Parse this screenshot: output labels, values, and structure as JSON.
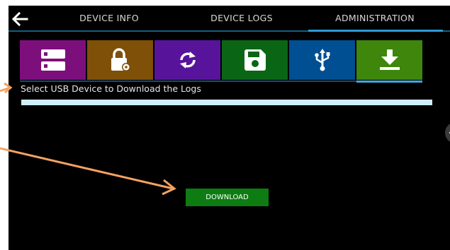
{
  "nav": {
    "back_icon": "arrow-left-icon",
    "tabs": [
      {
        "label": "DEVICE INFO"
      },
      {
        "label": "DEVICE LOGS"
      },
      {
        "label": "ADMINISTRATION",
        "active": true
      }
    ]
  },
  "tiles": [
    {
      "icon": "server-icon",
      "color": "#7d0f7d"
    },
    {
      "icon": "lock-gear-icon",
      "color": "#7e5008"
    },
    {
      "icon": "sync-icon",
      "color": "#57149b"
    },
    {
      "icon": "floppy-disk-icon",
      "color": "#0a6614"
    },
    {
      "icon": "usb-icon",
      "color": "#004f92"
    },
    {
      "icon": "download-icon",
      "color": "#3f860c",
      "active": true
    }
  ],
  "main": {
    "select_label": "Select USB Device to Download the Logs",
    "download_button": "DOWNLOAD"
  },
  "colors": {
    "accent": "#2e9ad6",
    "annotation_arrow": "#f4a261"
  }
}
